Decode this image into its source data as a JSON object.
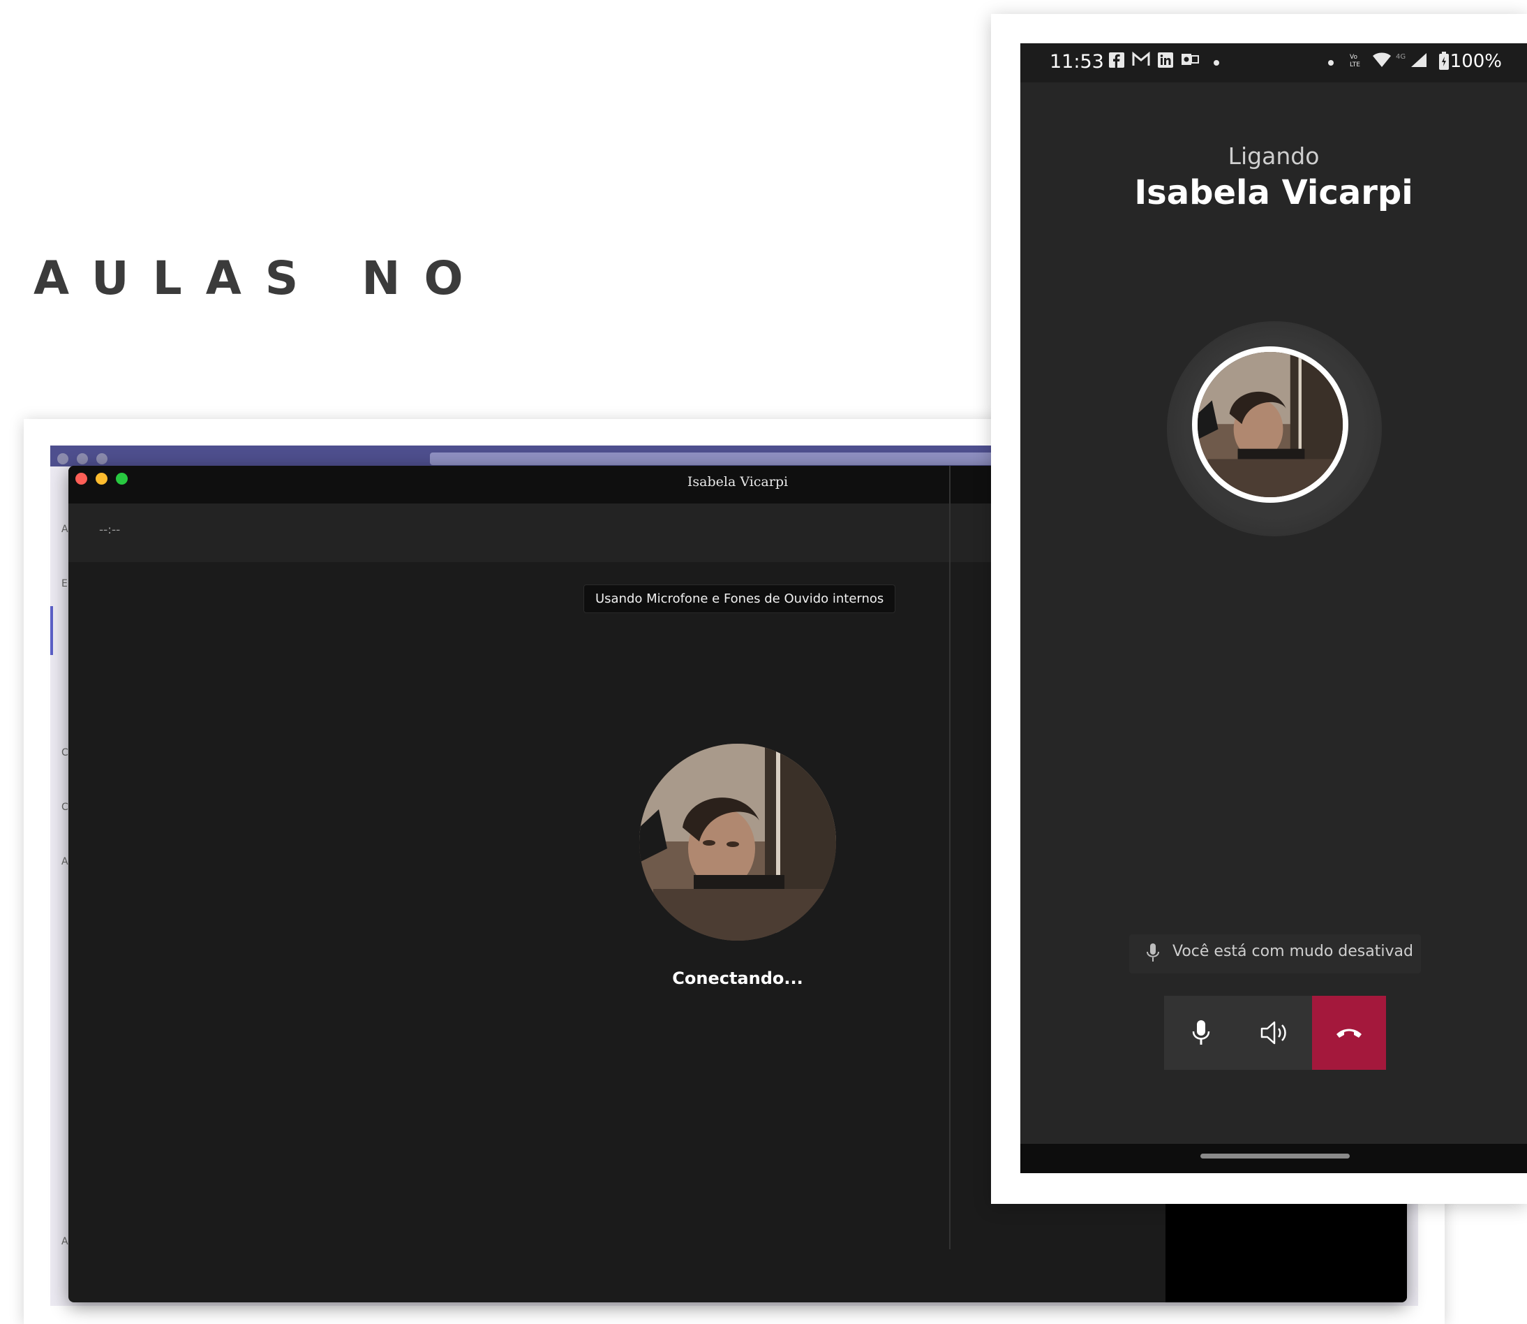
{
  "page": {
    "heading": "AULAS NO"
  },
  "desktop": {
    "window_title": "Isabela Vicarpi",
    "call_timer": "--:--",
    "device_tooltip": "Usando Microfone e Fones de Ouvido internos",
    "status_text": "Conectando...",
    "traffic_lights": {
      "close_color": "#ff5f57",
      "minimize_color": "#febc2e",
      "zoom_color": "#28c840"
    },
    "sidebar_letters": [
      "A",
      "E",
      "Ca",
      "Cl",
      "A",
      "Ap"
    ]
  },
  "phone": {
    "status_bar": {
      "time": "11:53",
      "battery": "100%",
      "notification_icons": [
        "facebook-icon",
        "gmail-icon",
        "linkedin-icon",
        "outlook-icon"
      ],
      "system_icons": [
        "volte-icon",
        "wifi-icon",
        "4g-icon",
        "signal-icon",
        "battery-icon"
      ]
    },
    "call_state": "Ligando",
    "caller_name": "Isabela Vicarpi",
    "mute_notice": "Você está com mudo desativad",
    "hangup_color": "#a4183c"
  }
}
